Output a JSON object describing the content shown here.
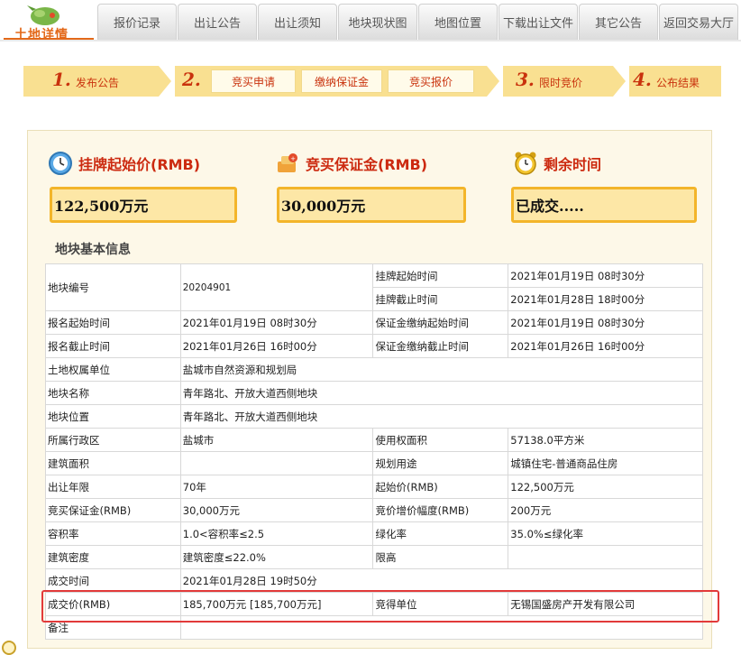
{
  "header": {
    "logo_text": "土地详情",
    "nav": [
      {
        "label": "报价记录"
      },
      {
        "label": "出让公告"
      },
      {
        "label": "出让须知"
      },
      {
        "label": "地块现状图"
      },
      {
        "label": "地图位置"
      },
      {
        "label": "下载出让文件"
      },
      {
        "label": "其它公告"
      },
      {
        "label": "返回交易大厅"
      }
    ]
  },
  "steps": {
    "step1": {
      "num": "1.",
      "label": "发布公告"
    },
    "step2": {
      "num": "2.",
      "subs": [
        "竞买申请",
        "缴纳保证金",
        "竞买报价"
      ]
    },
    "step3": {
      "num": "3.",
      "label": "限时竞价"
    },
    "step4": {
      "num": "4.",
      "label": "公布结果"
    }
  },
  "metrics": {
    "start_price": {
      "title": "挂牌起始价(RMB)",
      "value": "122,500万元",
      "icon": "clock-icon"
    },
    "deposit": {
      "title": "竞买保证金(RMB)",
      "value": "30,000万元",
      "icon": "money-icon"
    },
    "remaining": {
      "title": "剩余时间",
      "value": "已成交.....",
      "icon": "alarm-clock-icon"
    }
  },
  "section_title": "地块基本信息",
  "table": {
    "parcel_no_label": "地块编号",
    "parcel_no": "20204901",
    "list_start_label": "挂牌起始时间",
    "list_start": "2021年01月19日 08时30分",
    "list_end_label": "挂牌截止时间",
    "list_end": "2021年01月28日 18时00分",
    "reg_start_label": "报名起始时间",
    "reg_start": "2021年01月19日 08时30分",
    "dep_start_label": "保证金缴纳起始时间",
    "dep_start": "2021年01月19日 08时30分",
    "reg_end_label": "报名截止时间",
    "reg_end": "2021年01月26日 16时00分",
    "dep_end_label": "保证金缴纳截止时间",
    "dep_end": "2021年01月26日 16时00分",
    "owner_label": "土地权属单位",
    "owner": "盐城市自然资源和规划局",
    "name_label": "地块名称",
    "name": "青年路北、开放大道西侧地块",
    "location_label": "地块位置",
    "location": "青年路北、开放大道西侧地块",
    "district_label": "所属行政区",
    "district": "盐城市",
    "area_label": "使用权面积",
    "area": "57138.0平方米",
    "build_area_label": "建筑面积",
    "build_area": "",
    "usage_label": "规划用途",
    "usage": "城镇住宅-普通商品住房",
    "term_label": "出让年限",
    "term": "70年",
    "start_price_label": "起始价(RMB)",
    "start_price": "122,500万元",
    "deposit_label": "竞买保证金(RMB)",
    "deposit": "30,000万元",
    "increment_label": "竞价增价幅度(RMB)",
    "increment": "200万元",
    "far_label": "容积率",
    "far": "1.0<容积率≤2.5",
    "green_label": "绿化率",
    "green": "35.0%≤绿化率",
    "density_label": "建筑密度",
    "density": "建筑密度≤22.0%",
    "height_label": "限高",
    "height": "",
    "deal_time_label": "成交时间",
    "deal_time": "2021年01月28日 19时50分",
    "deal_price_label": "成交价(RMB)",
    "deal_price": "185,700万元 [185,700万元]",
    "winner_label": "竞得单位",
    "winner": "无锡国盛房产开发有限公司",
    "remark_label": "备注",
    "remark": ""
  }
}
